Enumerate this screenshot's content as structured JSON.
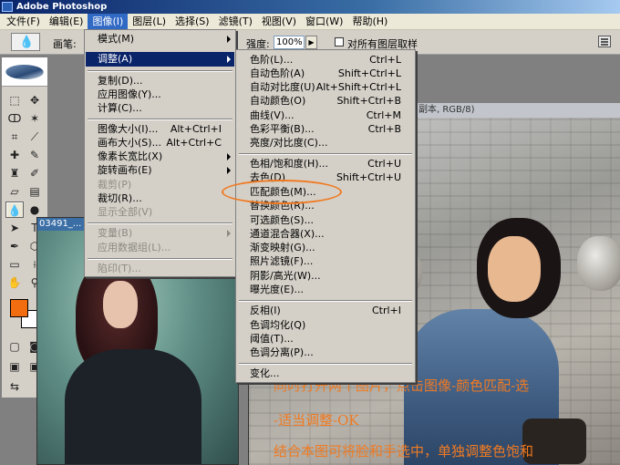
{
  "app": {
    "title": "Adobe Photoshop"
  },
  "menubar": {
    "items": [
      {
        "label": "文件(F)"
      },
      {
        "label": "编辑(E)"
      },
      {
        "label": "图像(I)"
      },
      {
        "label": "图层(L)"
      },
      {
        "label": "选择(S)"
      },
      {
        "label": "滤镜(T)"
      },
      {
        "label": "视图(V)"
      },
      {
        "label": "窗口(W)"
      },
      {
        "label": "帮助(H)"
      }
    ],
    "active_index": 2
  },
  "options": {
    "brush_label": "画笔:",
    "strength_label": "强度:",
    "strength_value": "100%",
    "all_layers_label": "对所有图层取样"
  },
  "image_menu": {
    "items": [
      {
        "label": "模式(M)",
        "submenu": true
      },
      {
        "label": "调整(A)",
        "submenu": true,
        "active": true
      },
      {
        "label": "复制(D)..."
      },
      {
        "label": "应用图像(Y)..."
      },
      {
        "label": "计算(C)..."
      },
      {
        "label": "图像大小(I)...",
        "shortcut": "Alt+Ctrl+I"
      },
      {
        "label": "画布大小(S)...",
        "shortcut": "Alt+Ctrl+C"
      },
      {
        "label": "像素长宽比(X)",
        "submenu": true
      },
      {
        "label": "旋转画布(E)",
        "submenu": true
      },
      {
        "label": "裁剪(P)",
        "disabled": true
      },
      {
        "label": "裁切(R)..."
      },
      {
        "label": "显示全部(V)",
        "disabled": true
      },
      {
        "label": "变量(B)",
        "submenu": true,
        "disabled": true
      },
      {
        "label": "应用数据组(L)...",
        "disabled": true
      },
      {
        "label": "陷印(T)...",
        "disabled": true
      }
    ]
  },
  "adjust_menu": {
    "items": [
      {
        "label": "色阶(L)...",
        "shortcut": "Ctrl+L"
      },
      {
        "label": "自动色阶(A)",
        "shortcut": "Shift+Ctrl+L"
      },
      {
        "label": "自动对比度(U)",
        "shortcut": "Alt+Shift+Ctrl+L"
      },
      {
        "label": "自动颜色(O)",
        "shortcut": "Shift+Ctrl+B"
      },
      {
        "label": "曲线(V)...",
        "shortcut": "Ctrl+M"
      },
      {
        "label": "色彩平衡(B)...",
        "shortcut": "Ctrl+B"
      },
      {
        "label": "亮度/对比度(C)..."
      },
      {
        "label": "色相/饱和度(H)...",
        "shortcut": "Ctrl+U"
      },
      {
        "label": "去色(D)",
        "shortcut": "Shift+Ctrl+U"
      },
      {
        "label": "匹配颜色(M)...",
        "highlighted": true
      },
      {
        "label": "替换颜色(R)..."
      },
      {
        "label": "可选颜色(S)..."
      },
      {
        "label": "通道混合器(X)..."
      },
      {
        "label": "渐变映射(G)..."
      },
      {
        "label": "照片滤镜(F)..."
      },
      {
        "label": "阴影/高光(W)..."
      },
      {
        "label": "曝光度(E)..."
      },
      {
        "label": "反相(I)",
        "shortcut": "Ctrl+I"
      },
      {
        "label": "色调均化(Q)"
      },
      {
        "label": "阈值(T)..."
      },
      {
        "label": "色调分离(P)..."
      },
      {
        "label": "变化..."
      }
    ]
  },
  "documents": {
    "left_title": "03491_...",
    "right_title": "副本, RGB/8)"
  },
  "annotation": {
    "line1": "同时打开两个图片，点击图像-颜色匹配-选",
    "line2": "-适当调整-OK",
    "line3": "结合本图可将脸和手选中，单独调整色饱和"
  },
  "colors": {
    "foreground": "#f26c10",
    "background": "#ffffff",
    "menu_highlight": "#0a246a",
    "annotation": "#f07a22"
  }
}
